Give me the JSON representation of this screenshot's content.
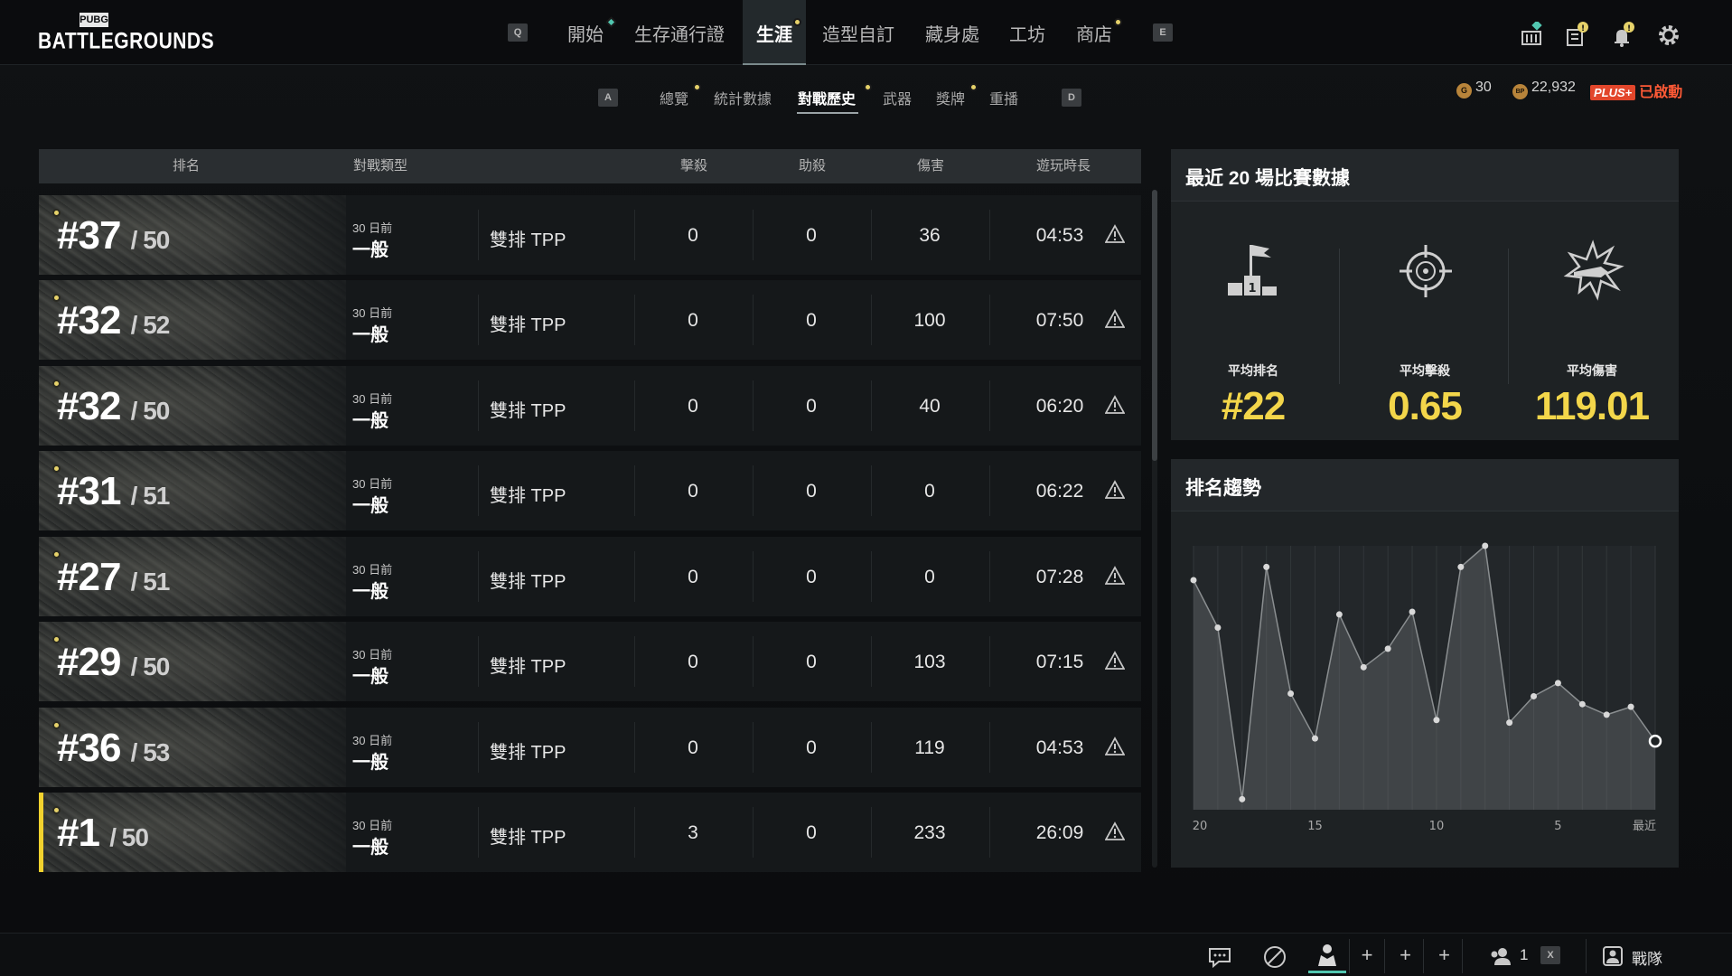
{
  "logo": {
    "top": "PUBG",
    "main": "BATTLEGROUNDS"
  },
  "main_nav": {
    "left_key": "Q",
    "right_key": "E",
    "items": [
      {
        "label": "開始",
        "dot": "teal"
      },
      {
        "label": "生存通行證",
        "dot": ""
      },
      {
        "label": "生涯",
        "dot": "yellow",
        "active": true
      },
      {
        "label": "造型自訂",
        "dot": ""
      },
      {
        "label": "藏身處",
        "dot": ""
      },
      {
        "label": "工坊",
        "dot": ""
      },
      {
        "label": "商店",
        "dot": "yellow"
      }
    ]
  },
  "sub_nav": {
    "left_key": "A",
    "right_key": "D",
    "items": [
      {
        "label": "總覽",
        "dot": true
      },
      {
        "label": "統計數據",
        "dot": false
      },
      {
        "label": "對戰歷史",
        "dot": true,
        "active": true
      },
      {
        "label": "武器",
        "dot": false
      },
      {
        "label": "獎牌",
        "dot": true
      },
      {
        "label": "重播",
        "dot": false
      }
    ]
  },
  "currency": {
    "g_coin_symbol": "G",
    "g_coin": "30",
    "bp_symbol": "BP",
    "bp": "22,932",
    "plus_badge": "PLUS+",
    "plus_status": "已啟動"
  },
  "table": {
    "headers": [
      "排名",
      "對戰類型",
      "擊殺",
      "助殺",
      "傷害",
      "遊玩時長"
    ],
    "rows": [
      {
        "rank": "#37",
        "total": "/ 50",
        "ago": "30 日前",
        "mode": "一般",
        "type": "雙排 TPP",
        "kills": "0",
        "assists": "0",
        "damage": "36",
        "time": "04:53"
      },
      {
        "rank": "#32",
        "total": "/ 52",
        "ago": "30 日前",
        "mode": "一般",
        "type": "雙排 TPP",
        "kills": "0",
        "assists": "0",
        "damage": "100",
        "time": "07:50"
      },
      {
        "rank": "#32",
        "total": "/ 50",
        "ago": "30 日前",
        "mode": "一般",
        "type": "雙排 TPP",
        "kills": "0",
        "assists": "0",
        "damage": "40",
        "time": "06:20"
      },
      {
        "rank": "#31",
        "total": "/ 51",
        "ago": "30 日前",
        "mode": "一般",
        "type": "雙排 TPP",
        "kills": "0",
        "assists": "0",
        "damage": "0",
        "time": "06:22"
      },
      {
        "rank": "#27",
        "total": "/ 51",
        "ago": "30 日前",
        "mode": "一般",
        "type": "雙排 TPP",
        "kills": "0",
        "assists": "0",
        "damage": "0",
        "time": "07:28"
      },
      {
        "rank": "#29",
        "total": "/ 50",
        "ago": "30 日前",
        "mode": "一般",
        "type": "雙排 TPP",
        "kills": "0",
        "assists": "0",
        "damage": "103",
        "time": "07:15"
      },
      {
        "rank": "#36",
        "total": "/ 53",
        "ago": "30 日前",
        "mode": "一般",
        "type": "雙排 TPP",
        "kills": "0",
        "assists": "0",
        "damage": "119",
        "time": "04:53"
      },
      {
        "rank": "#1",
        "total": "/ 50",
        "ago": "30 日前",
        "mode": "一般",
        "type": "雙排 TPP",
        "kills": "3",
        "assists": "0",
        "damage": "233",
        "time": "26:09",
        "win": true
      }
    ]
  },
  "recent_stats": {
    "title": "最近 20 場比賽數據",
    "stats": [
      {
        "label": "平均排名",
        "value": "#22",
        "icon": "podium-flag-icon"
      },
      {
        "label": "平均擊殺",
        "value": "0.65",
        "icon": "crosshair-icon"
      },
      {
        "label": "平均傷害",
        "value": "119.01",
        "icon": "bullet-impact-icon"
      }
    ]
  },
  "rank_trend": {
    "title": "排名趨勢",
    "x_labels": [
      "20",
      "15",
      "10",
      "5",
      "最近"
    ]
  },
  "chart_data": {
    "type": "area",
    "title": "排名趨勢",
    "x_tick_labels": [
      "20",
      "15",
      "10",
      "5",
      "最近"
    ],
    "x": [
      20,
      19,
      18,
      17,
      16,
      15,
      14,
      13,
      12,
      11,
      10,
      9,
      8,
      7,
      6,
      5,
      4,
      3,
      2,
      1
    ],
    "values": [
      0.87,
      0.69,
      0.04,
      0.92,
      0.44,
      0.27,
      0.74,
      0.54,
      0.61,
      0.75,
      0.34,
      0.92,
      1.0,
      0.33,
      0.43,
      0.48,
      0.4,
      0.36,
      0.39,
      0.26
    ],
    "value_meaning": "relative placement score (higher = better), no printed y-axis",
    "ylim": [
      0,
      1
    ],
    "grid": true,
    "highlight_last": true
  },
  "bottom_bar": {
    "party_count": "1",
    "party_key": "X",
    "team_label": "戰隊"
  },
  "colors": {
    "accent_yellow": "#f3d64a",
    "plus_red": "#e2462b",
    "teal": "#51c7b0"
  }
}
